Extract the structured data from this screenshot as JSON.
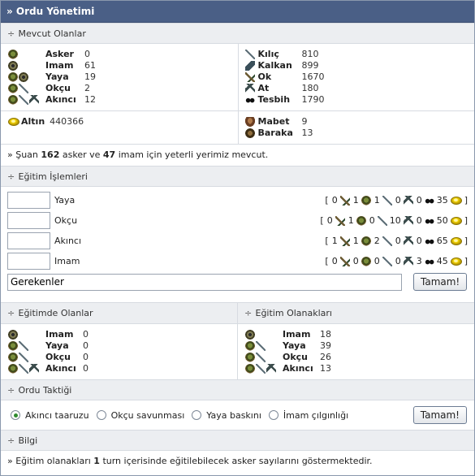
{
  "title": "» Ordu Yönetimi",
  "mevcut": {
    "header": "Mevcut Olanlar",
    "units": [
      {
        "label": "Asker",
        "value": "0",
        "icons": [
          "soldier-icon"
        ]
      },
      {
        "label": "Imam",
        "value": "61",
        "icons": [
          "imam-icon"
        ]
      },
      {
        "label": "Yaya",
        "value": "19",
        "icons": [
          "soldier-icon",
          "imam-icon"
        ]
      },
      {
        "label": "Okçu",
        "value": "2",
        "icons": [
          "soldier-icon",
          "sword-icon"
        ]
      },
      {
        "label": "Akıncı",
        "value": "12",
        "icons": [
          "soldier-icon",
          "sword-icon",
          "horse-icon"
        ]
      }
    ],
    "items": [
      {
        "label": "Kılıç",
        "value": "810",
        "icon": "sword-icon"
      },
      {
        "label": "Kalkan",
        "value": "899",
        "icon": "shield-icon"
      },
      {
        "label": "Ok",
        "value": "1670",
        "icon": "arrow-icon"
      },
      {
        "label": "At",
        "value": "180",
        "icon": "horse-icon"
      },
      {
        "label": "Tesbih",
        "value": "1790",
        "icon": "beads-icon"
      }
    ],
    "gold": {
      "label": "Altın",
      "value": "440366"
    },
    "buildings": [
      {
        "label": "Mabet",
        "value": "9",
        "icon": "temple-icon"
      },
      {
        "label": "Baraka",
        "value": "13",
        "icon": "barracks-icon"
      }
    ],
    "info_prefix": "» Şuan",
    "info_asker": "162",
    "info_mid": "asker ve",
    "info_imam": "47",
    "info_suffix": "imam için yeterli yerimiz mevcut."
  },
  "egitim": {
    "header": "Eğitim İşlemleri",
    "rows": [
      {
        "name": "Yaya",
        "cost": [
          "0",
          "1",
          "1",
          "0",
          "0",
          "35"
        ]
      },
      {
        "name": "Okçu",
        "cost": [
          "0",
          "1",
          "0",
          "10",
          "0",
          "50"
        ]
      },
      {
        "name": "Akıncı",
        "cost": [
          "1",
          "1",
          "2",
          "0",
          "0",
          "65"
        ]
      },
      {
        "name": "Imam",
        "cost": [
          "0",
          "0",
          "0",
          "0",
          "3",
          "45"
        ]
      }
    ],
    "requirements_value": "Gerekenler",
    "submit": "Tamam!"
  },
  "egitimde": {
    "header": "Eğitimde Olanlar",
    "units": [
      {
        "label": "Imam",
        "value": "0"
      },
      {
        "label": "Yaya",
        "value": "0"
      },
      {
        "label": "Okçu",
        "value": "0"
      },
      {
        "label": "Akıncı",
        "value": "0"
      }
    ]
  },
  "olanaklar": {
    "header": "Eğitim Olanakları",
    "units": [
      {
        "label": "Imam",
        "value": "18"
      },
      {
        "label": "Yaya",
        "value": "39"
      },
      {
        "label": "Okçu",
        "value": "26"
      },
      {
        "label": "Akıncı",
        "value": "13"
      }
    ]
  },
  "taktik": {
    "header": "Ordu Taktiği",
    "options": [
      "Akıncı taaruzu",
      "Okçu savunması",
      "Yaya baskını",
      "İmam çılgınlığı"
    ],
    "selected": 0,
    "submit": "Tamam!"
  },
  "bilgi": {
    "header": "Bilgi",
    "prefix": "» Eğitim olanakları",
    "bold": "1",
    "suffix": "turn içerisinde eğitilebilecek asker sayılarını göstermektedir."
  }
}
